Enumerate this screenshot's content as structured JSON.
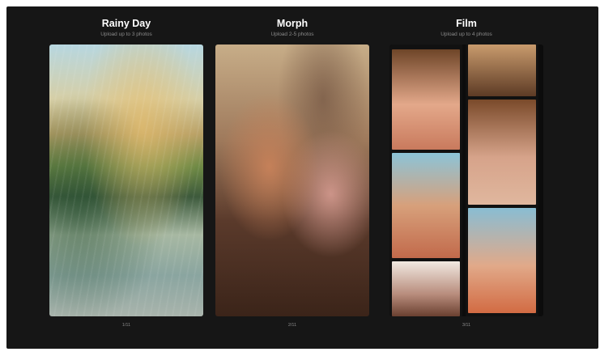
{
  "cards": [
    {
      "title": "Rainy Day",
      "subtitle": "Upload up to 3 photos",
      "page": "1/11"
    },
    {
      "title": "Morph",
      "subtitle": "Upload 2-5 photos",
      "page": "2/11"
    },
    {
      "title": "Film",
      "subtitle": "Upload up to 4 photos",
      "page": "3/11"
    }
  ],
  "colors": {
    "background": "#161616",
    "title": "#ffffff",
    "subtitle": "#8a8a8a"
  }
}
